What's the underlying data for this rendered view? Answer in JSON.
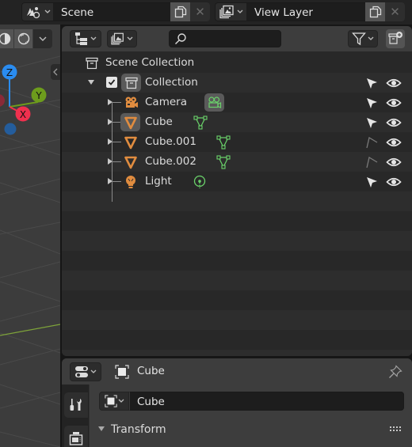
{
  "topbar": {
    "scene": {
      "icon": "scene-icon",
      "name": "Scene",
      "copy_icon": "duplicate-icon",
      "close_icon": "close-icon"
    },
    "view_layer": {
      "icon": "view-layer-icon",
      "name": "View Layer",
      "copy_icon": "duplicate-icon",
      "close_icon": "close-icon"
    }
  },
  "viewport": {
    "gizmo": {
      "z": "Z",
      "y": "Y",
      "x": "X"
    },
    "axis_colors": {
      "x": "#f0304e",
      "y": "#6d9c1c",
      "z": "#2a8cf0"
    }
  },
  "outliner": {
    "header": {
      "display_mode_icon": "outliner-display-mode-icon",
      "view_layer_icon": "view-layer-icon",
      "search_placeholder": "",
      "search_value": "",
      "filter_icon": "filter-icon",
      "new_collection_icon": "new-collection-icon"
    },
    "scene_collection": {
      "label": "Scene Collection",
      "icon": "collection-icon"
    },
    "collection": {
      "label": "Collection",
      "checked": true,
      "expanded": true
    },
    "items": [
      {
        "label": "Camera",
        "type": "camera",
        "data_icon": "camera-data-icon",
        "selectable": true,
        "visible": true
      },
      {
        "label": "Cube",
        "type": "mesh",
        "data_icon": "mesh-data-icon",
        "selectable": true,
        "visible": true,
        "active": true
      },
      {
        "label": "Cube.001",
        "type": "mesh",
        "data_icon": "mesh-data-icon",
        "selectable": false,
        "visible": true
      },
      {
        "label": "Cube.002",
        "type": "mesh",
        "data_icon": "mesh-data-icon",
        "selectable": false,
        "visible": true
      },
      {
        "label": "Light",
        "type": "light",
        "data_icon": "light-data-icon",
        "selectable": true,
        "visible": true
      }
    ],
    "colors": {
      "object_icon": "#e08c3f",
      "data_icon": "#6ad26a"
    }
  },
  "properties": {
    "header": {
      "context_label": "Cube",
      "pin_icon": "pin-icon"
    },
    "tabs": [
      {
        "name": "tool",
        "icon": "tool-icon"
      },
      {
        "name": "render",
        "icon": "render-icon"
      }
    ],
    "object_name": "Cube",
    "panel_title": "Transform"
  }
}
